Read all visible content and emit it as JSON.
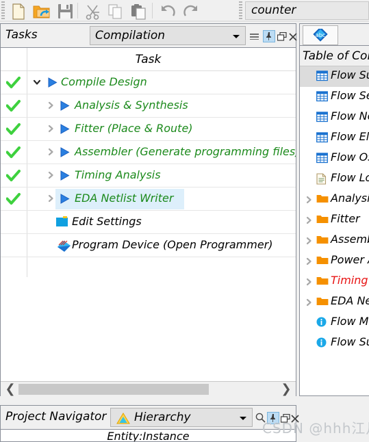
{
  "toolbar": {
    "buttons": [
      {
        "name": "new-file-icon",
        "label": "New"
      },
      {
        "name": "open-folder-icon",
        "label": "Open"
      },
      {
        "name": "save-icon",
        "label": "Save"
      },
      {
        "name": "cut-icon",
        "label": "Cut"
      },
      {
        "name": "copy-icon",
        "label": "Copy"
      },
      {
        "name": "paste-icon",
        "label": "Paste"
      },
      {
        "name": "undo-icon",
        "label": "Undo"
      },
      {
        "name": "redo-icon",
        "label": "Redo"
      }
    ],
    "project_field_value": "counter"
  },
  "tasks_panel": {
    "title": "Tasks",
    "flow_selected": "Compilation",
    "column_header": "Task",
    "header_controls": [
      {
        "name": "panel-menu-icon",
        "label": "Menu"
      },
      {
        "name": "pin-icon",
        "label": "Pin"
      },
      {
        "name": "restore-icon",
        "label": "Restore"
      },
      {
        "name": "close-icon",
        "label": "Close"
      }
    ],
    "rows": [
      {
        "label": "Compile Design",
        "status": "done",
        "indent": 0,
        "twisty": "down",
        "icon": "play-triangle",
        "selected": false,
        "color": "green"
      },
      {
        "label": "Analysis & Synthesis",
        "status": "done",
        "indent": 1,
        "twisty": "right",
        "icon": "play-triangle",
        "selected": false,
        "color": "green"
      },
      {
        "label": "Fitter (Place & Route)",
        "status": "done",
        "indent": 1,
        "twisty": "right",
        "icon": "play-triangle",
        "selected": false,
        "color": "green"
      },
      {
        "label": "Assembler (Generate programming files)",
        "status": "done",
        "indent": 1,
        "twisty": "right",
        "icon": "play-triangle",
        "selected": false,
        "color": "green"
      },
      {
        "label": "Timing Analysis",
        "status": "done",
        "indent": 1,
        "twisty": "right",
        "icon": "play-triangle",
        "selected": false,
        "color": "green"
      },
      {
        "label": "EDA Netlist Writer",
        "status": "done",
        "indent": 1,
        "twisty": "right",
        "icon": "play-triangle",
        "selected": true,
        "color": "green"
      },
      {
        "label": "Edit Settings",
        "status": "none",
        "indent": 1,
        "twisty": "none",
        "icon": "settings-square",
        "selected": false,
        "color": "dark"
      },
      {
        "label": "Program Device (Open Programmer)",
        "status": "none",
        "indent": 1,
        "twisty": "none",
        "icon": "programmer-diamond",
        "selected": false,
        "color": "dark"
      }
    ]
  },
  "project_navigator": {
    "title": "Project Navigator",
    "view_selected": "Hierarchy",
    "column_header": "Entity:Instance",
    "header_controls": [
      {
        "name": "search-icon",
        "label": "Search"
      },
      {
        "name": "pin-icon",
        "label": "Pin"
      },
      {
        "name": "restore-icon",
        "label": "Restore"
      },
      {
        "name": "close-icon",
        "label": "Close"
      }
    ]
  },
  "toc_panel": {
    "tab_icon": "abc-spellcheck-icon",
    "title": "Table of Contents",
    "items": [
      {
        "label": "Flow Summary",
        "icon": "table-icon",
        "expandable": false,
        "selected": true,
        "color": "black"
      },
      {
        "label": "Flow Settings",
        "icon": "table-icon",
        "expandable": false,
        "selected": false,
        "color": "black"
      },
      {
        "label": "Flow Non-Default Global Settings",
        "icon": "table-icon",
        "expandable": false,
        "selected": false,
        "color": "black"
      },
      {
        "label": "Flow Elapsed Time",
        "icon": "table-icon",
        "expandable": false,
        "selected": false,
        "color": "black"
      },
      {
        "label": "Flow OS Summary",
        "icon": "table-icon",
        "expandable": false,
        "selected": false,
        "color": "black"
      },
      {
        "label": "Flow Log",
        "icon": "document-icon",
        "expandable": false,
        "selected": false,
        "color": "black"
      },
      {
        "label": "Analysis & Synthesis",
        "icon": "folder-icon",
        "expandable": true,
        "selected": false,
        "color": "black"
      },
      {
        "label": "Fitter",
        "icon": "folder-icon",
        "expandable": true,
        "selected": false,
        "color": "black"
      },
      {
        "label": "Assembler",
        "icon": "folder-icon",
        "expandable": true,
        "selected": false,
        "color": "black"
      },
      {
        "label": "Power Analyzer",
        "icon": "folder-icon",
        "expandable": true,
        "selected": false,
        "color": "black"
      },
      {
        "label": "Timing Analyzer",
        "icon": "folder-icon",
        "expandable": true,
        "selected": false,
        "color": "red"
      },
      {
        "label": "EDA Netlist Writer",
        "icon": "folder-icon",
        "expandable": true,
        "selected": false,
        "color": "black"
      },
      {
        "label": "Flow Messages",
        "icon": "info-icon",
        "expandable": false,
        "selected": false,
        "color": "black"
      },
      {
        "label": "Flow Suppressed Messages",
        "icon": "info-icon",
        "expandable": false,
        "selected": false,
        "color": "black"
      }
    ]
  },
  "watermark": {
    "text": "CSDN @hhh江月"
  },
  "colors": {
    "accent_blue": "#1a72d0",
    "task_green": "#1c8a1c",
    "check_green": "#3ed13e",
    "selection_blue": "#ddeffb",
    "folder_orange": "#f59000",
    "error_red": "#e81414",
    "panel_gray": "#f0f0f0"
  }
}
